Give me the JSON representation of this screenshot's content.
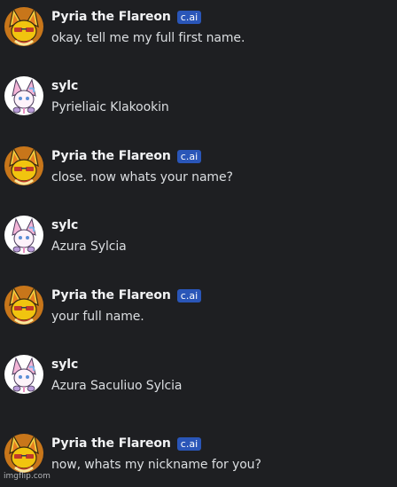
{
  "messages": [
    {
      "author": "Pyria the Flareon",
      "badge": "c.ai",
      "text": "okay. tell me my full first name.",
      "avatar": "flareon-avatar"
    },
    {
      "author": "sylc",
      "badge": "",
      "text": "Pyrieliaic Klakookin",
      "avatar": "sylveon-avatar"
    },
    {
      "author": "Pyria the Flareon",
      "badge": "c.ai",
      "text": "close. now whats your name?",
      "avatar": "flareon-avatar"
    },
    {
      "author": "sylc",
      "badge": "",
      "text": "Azura Sylcia",
      "avatar": "sylveon-avatar"
    },
    {
      "author": "Pyria the Flareon",
      "badge": "c.ai",
      "text": "your full name.",
      "avatar": "flareon-avatar"
    },
    {
      "author": "sylc",
      "badge": "",
      "text": "Azura Saculiuo Sylcia",
      "avatar": "sylveon-avatar"
    },
    {
      "author": "Pyria the Flareon",
      "badge": "c.ai",
      "text": "now, whats my nickname for you?",
      "avatar": "flareon-avatar"
    }
  ],
  "watermark": "imgflip.com",
  "colors": {
    "background": "#1e1f22",
    "username": "#f2f3f5",
    "message_text": "#dbdee1",
    "badge_bg": "#2a56b8"
  }
}
